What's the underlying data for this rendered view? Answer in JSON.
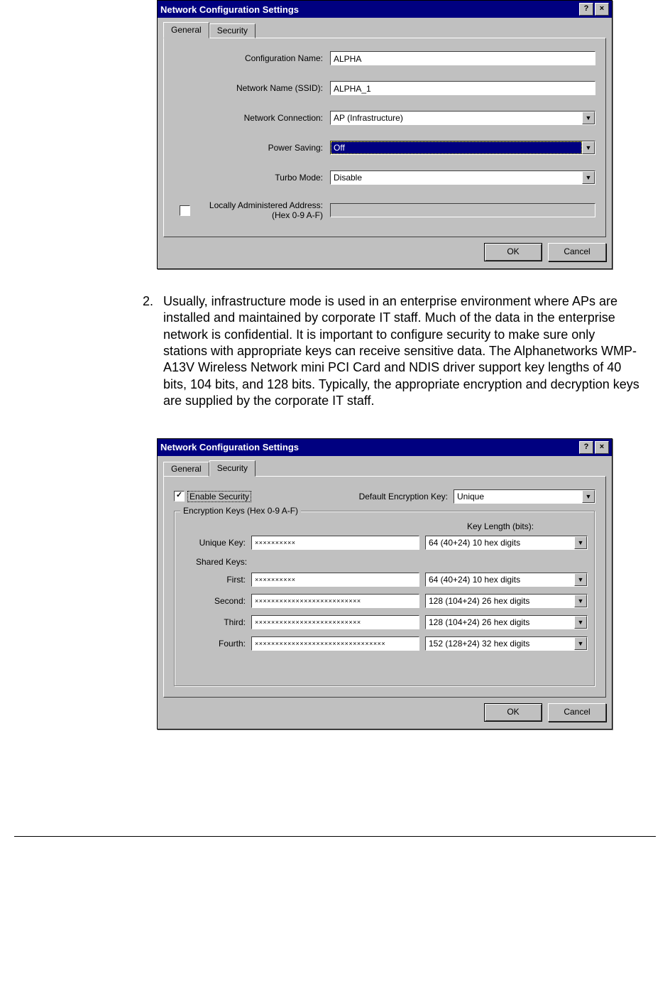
{
  "dialog1": {
    "title": "Network Configuration Settings",
    "tabs": {
      "general": "General",
      "security": "Security"
    },
    "fields": {
      "config_name_lbl": "Configuration Name:",
      "config_name_val": "ALPHA",
      "ssid_lbl": "Network Name (SSID):",
      "ssid_val": "ALPHA_1",
      "netconn_lbl": "Network Connection:",
      "netconn_val": "AP (Infrastructure)",
      "power_lbl": "Power Saving:",
      "power_val": "Off",
      "turbo_lbl": "Turbo Mode:",
      "turbo_val": "Disable",
      "laa_lbl": "Locally Administered Address:\n(Hex 0-9 A-F)"
    },
    "buttons": {
      "ok": "OK",
      "cancel": "Cancel"
    }
  },
  "paragraph": {
    "num": "2.",
    "text": "Usually, infrastructure mode is used in an enterprise environment where APs are installed and maintained by corporate IT staff. Much of the data in the enterprise network is confidential. It is important to configure security to make sure only stations with appropriate keys can receive sensitive data. The Alphanetworks WMP-A13V Wireless Network mini PCI Card and NDIS driver support key lengths of 40 bits, 104 bits, and 128 bits. Typically, the appropriate encryption and decryption keys are supplied by the corporate IT staff."
  },
  "dialog2": {
    "title": "Network Configuration Settings",
    "tabs": {
      "general": "General",
      "security": "Security"
    },
    "enable_security_lbl": "Enable Security",
    "enable_security_checked": "✓",
    "default_key_lbl": "Default Encryption Key:",
    "default_key_val": "Unique",
    "groupbox_title": "Encryption Keys (Hex 0-9 A-F)",
    "key_length_header": "Key Length (bits):",
    "unique_lbl": "Unique Key:",
    "unique_val": "××××××××××",
    "unique_len": "64  (40+24)  10 hex digits",
    "shared_lbl": "Shared Keys:",
    "keys": [
      {
        "lbl": "First:",
        "val": "××××××××××",
        "len": "64  (40+24)  10 hex digits"
      },
      {
        "lbl": "Second:",
        "val": "××××××××××××××××××××××××××",
        "len": "128 (104+24) 26 hex digits"
      },
      {
        "lbl": "Third:",
        "val": "××××××××××××××××××××××××××",
        "len": "128 (104+24) 26 hex digits"
      },
      {
        "lbl": "Fourth:",
        "val": "××××××××××××××××××××××××××××××××",
        "len": "152 (128+24) 32 hex digits"
      }
    ],
    "buttons": {
      "ok": "OK",
      "cancel": "Cancel"
    }
  }
}
